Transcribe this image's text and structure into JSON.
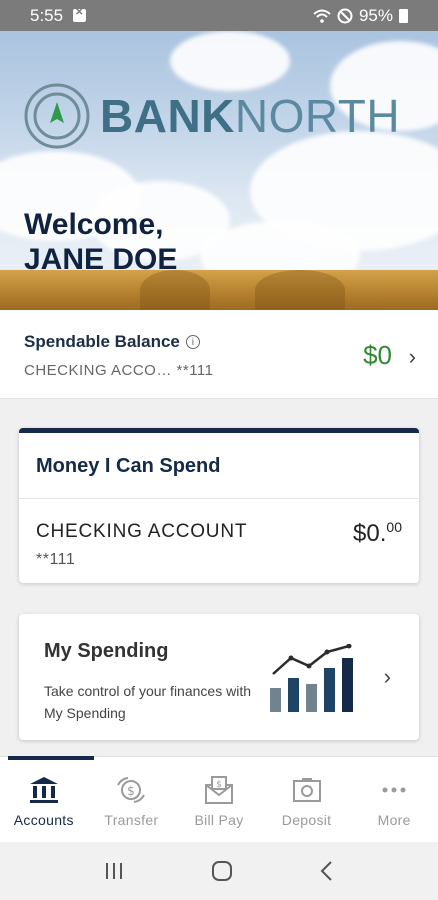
{
  "status_bar": {
    "time": "5:55",
    "battery": "95%"
  },
  "hero": {
    "logo_bank": "BANK",
    "logo_north": "NORTH",
    "welcome_line1": "Welcome,",
    "welcome_line2": "JANE DOE"
  },
  "spendable": {
    "title": "Spendable Balance",
    "account": "CHECKING ACCO… **111",
    "amount": "$0"
  },
  "money_card": {
    "title": "Money I Can Spend",
    "account_name": "CHECKING ACCOUNT",
    "account_number": "**111",
    "amount_dollars": "$0.",
    "amount_cents": "00"
  },
  "my_spending": {
    "title": "My Spending",
    "description": "Take control of your finances with My Spending",
    "icon": "bar-chart-trend-icon"
  },
  "bottom_nav": {
    "items": [
      {
        "label": "Accounts",
        "icon": "bank-icon",
        "active": true
      },
      {
        "label": "Transfer",
        "icon": "transfer-icon",
        "active": false
      },
      {
        "label": "Bill Pay",
        "icon": "bill-pay-icon",
        "active": false
      },
      {
        "label": "Deposit",
        "icon": "deposit-icon",
        "active": false
      },
      {
        "label": "More",
        "icon": "more-icon",
        "active": false
      }
    ]
  },
  "colors": {
    "primary": "#152a48",
    "balance_green": "#2f8a2f",
    "logo_teal": "#3f6f85"
  }
}
